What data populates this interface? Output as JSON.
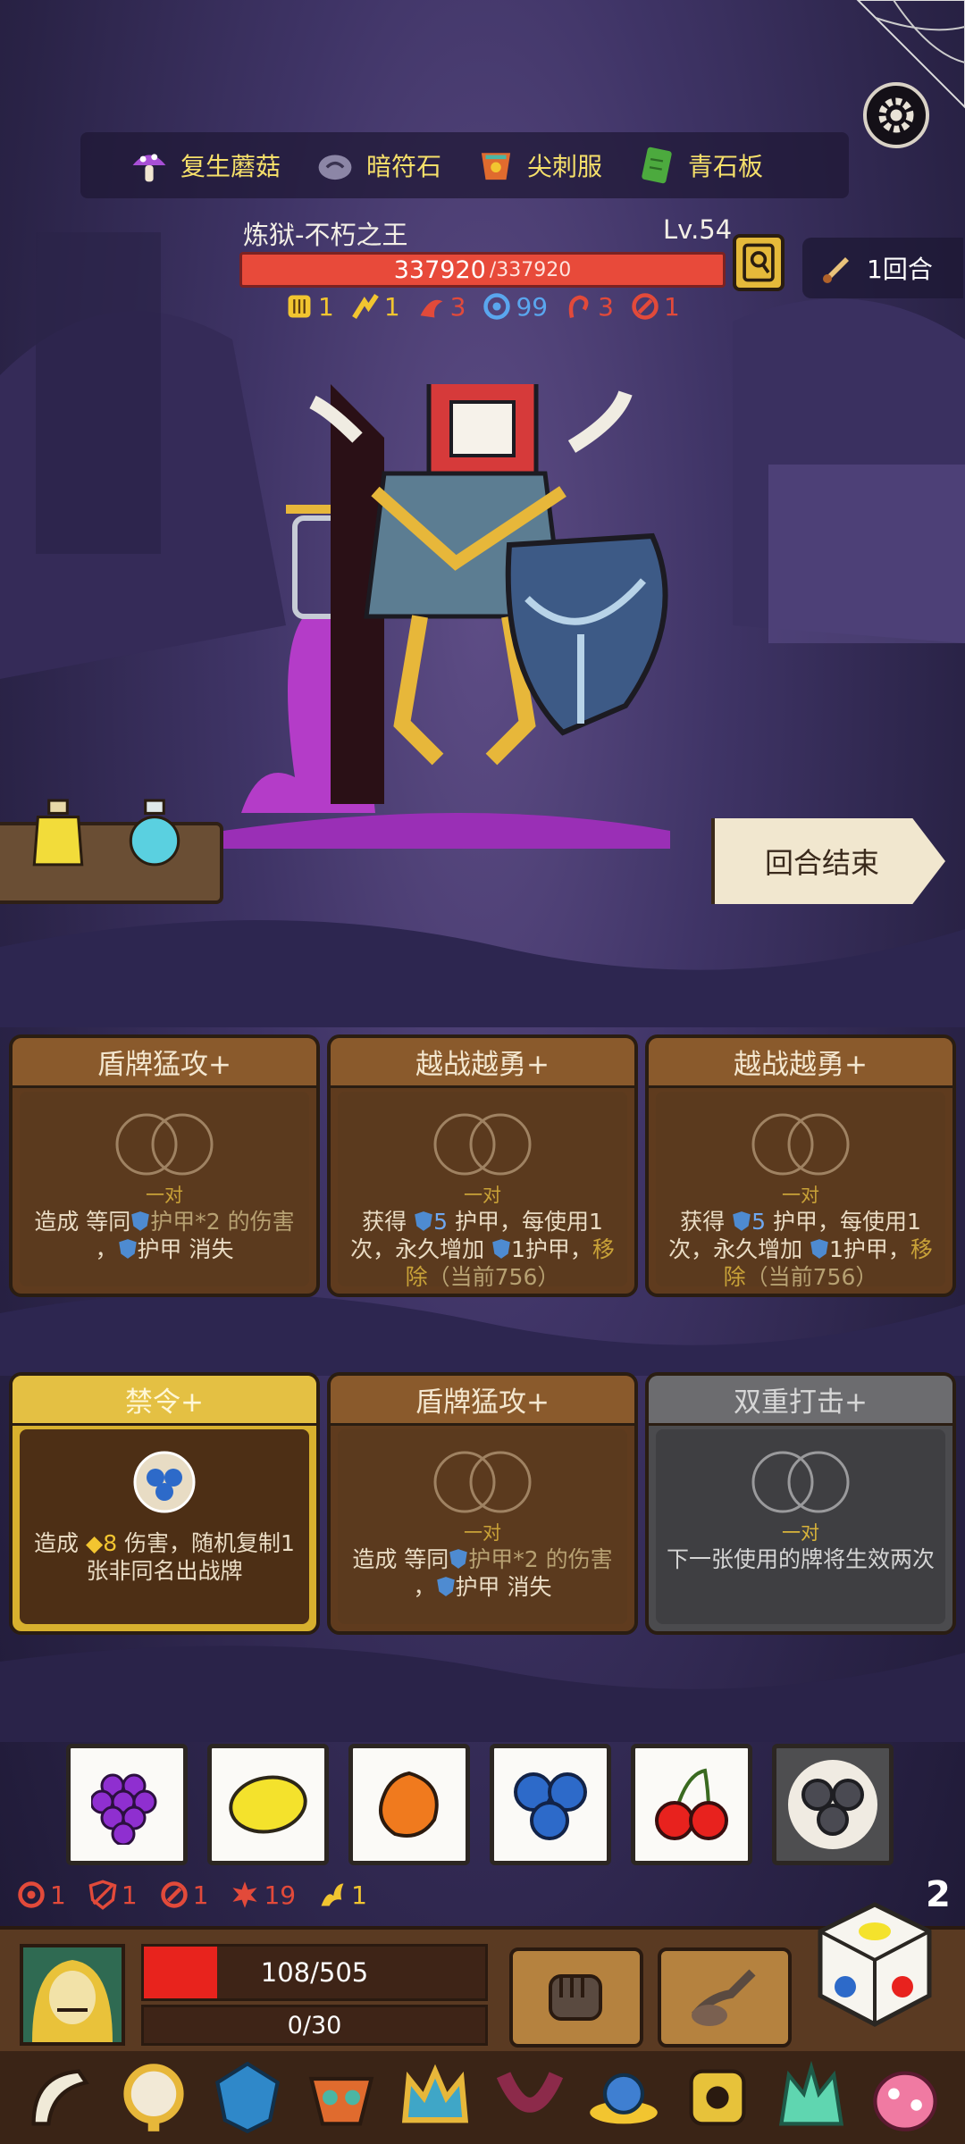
{
  "resources": [
    {
      "label": "复生蘑菇",
      "icon": "mushroom-icon"
    },
    {
      "label": "暗符石",
      "icon": "rune-stone-icon"
    },
    {
      "label": "尖刺服",
      "icon": "spike-armor-icon"
    },
    {
      "label": "青石板",
      "icon": "slate-tablet-icon"
    }
  ],
  "boss": {
    "name": "炼狱-不朽之王",
    "level": "Lv.54",
    "hp_current": "337920",
    "hp_max": "/337920",
    "status": [
      {
        "icon": "armor-icon",
        "value": "1",
        "color": "#f2c530"
      },
      {
        "icon": "strength-icon",
        "value": "1",
        "color": "#f2c530"
      },
      {
        "icon": "bleed-icon",
        "value": "3",
        "color": "#e24a3a"
      },
      {
        "icon": "shield-ring-icon",
        "value": "99",
        "color": "#5aa6ee"
      },
      {
        "icon": "curse-icon",
        "value": "3",
        "color": "#e24a3a"
      },
      {
        "icon": "weak-icon",
        "value": "1",
        "color": "#e24a3a"
      }
    ]
  },
  "round": {
    "label": "1回合"
  },
  "end_turn": {
    "label": "回合结束"
  },
  "cards": [
    {
      "title": "盾牌猛攻+",
      "pair": "一对",
      "desc_a": "造成 等同",
      "desc_b": "护甲*2 的伤害",
      "desc_c": "，",
      "desc_d": "护甲 消失"
    },
    {
      "title": "越战越勇+",
      "pair": "一对",
      "desc_a": "获得 ",
      "num": "5",
      "desc_b": " 护甲，每使用1次，永久增加 ",
      "desc_c": "1护甲，",
      "desc_d": "移除",
      "desc_e": "（当前756）"
    },
    {
      "title": "越战越勇+",
      "pair": "一对",
      "desc_a": "获得 ",
      "num": "5",
      "desc_b": " 护甲，每使用1次，永久增加 ",
      "desc_c": "1护甲，",
      "desc_d": "移除",
      "desc_e": "（当前756）"
    },
    {
      "title": "禁令+",
      "desc_a": "造成 ",
      "num": "8",
      "desc_b": " 伤害，随机复制1张非同名出战牌"
    },
    {
      "title": "盾牌猛攻+",
      "pair": "一对",
      "desc_a": "造成 等同",
      "desc_b": "护甲*2 的伤害",
      "desc_c": "，",
      "desc_d": "护甲 消失"
    },
    {
      "title": "双重打击+",
      "pair": "一对",
      "desc_a": "下一张使用的牌将生效两次"
    }
  ],
  "dice": [
    {
      "face": "grape-icon",
      "used": false
    },
    {
      "face": "lemon-icon",
      "used": false
    },
    {
      "face": "orange-icon",
      "used": false
    },
    {
      "face": "blueberry-icon",
      "used": false
    },
    {
      "face": "cherry-icon",
      "used": false
    },
    {
      "face": "blueberry-icon",
      "used": true
    }
  ],
  "player": {
    "status": [
      {
        "icon": "target-icon",
        "value": "1",
        "color": "#e24a3a"
      },
      {
        "icon": "broken-shield-icon",
        "value": "1",
        "color": "#e24a3a"
      },
      {
        "icon": "weak-icon",
        "value": "1",
        "color": "#e24a3a"
      },
      {
        "icon": "burn-icon",
        "value": "19",
        "color": "#e24a3a"
      },
      {
        "icon": "flame-bird-icon",
        "value": "1",
        "color": "#f2c530"
      }
    ],
    "hp_text": "108/505",
    "hp_fraction": 0.214,
    "shield_text": "0/30",
    "dice_count": "2"
  },
  "relics": [
    "horn-icon",
    "mirror-icon",
    "blue-gem-icon",
    "mask-icon",
    "crown-icon",
    "collar-icon",
    "snail-icon",
    "golden-idol-icon",
    "jade-crown-icon",
    "pink-egg-icon"
  ],
  "colors": {
    "boss_hp": "#e84a3a",
    "player_hp": "#e8231d",
    "card_brown": "#5f3b1e",
    "card_gold": "#d8b12e",
    "card_grey": "#4b4b4e"
  }
}
